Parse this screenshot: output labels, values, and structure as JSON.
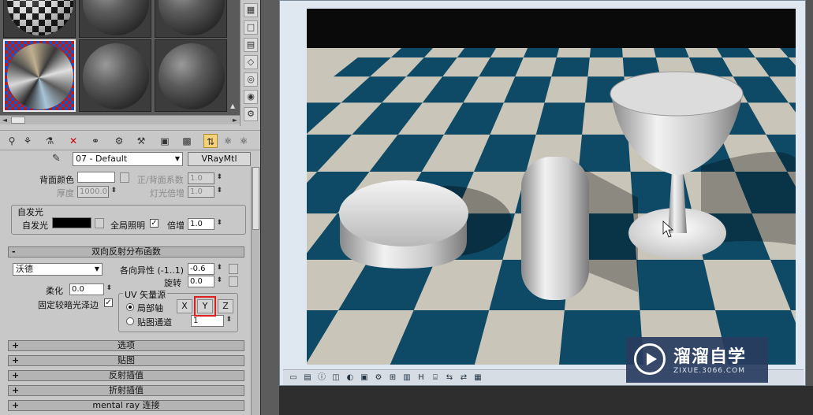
{
  "material_editor": {
    "material_name": "07 - Default",
    "material_type": "VRayMtl",
    "back_color": {
      "label": "背面颜色",
      "value": "#ffffff"
    },
    "front_back_coef": {
      "label": "正/背面系数",
      "value": "1.0"
    },
    "thickness": {
      "label": "厚度",
      "value": "1000.0"
    },
    "light_multiplier": {
      "label": "灯光倍增",
      "value": "1.0"
    },
    "self_illum": {
      "group_label": "自发光",
      "label": "自发光",
      "color": "#000000",
      "gi_label": "全局照明",
      "gi_checked": "✓",
      "mult_label": "倍增",
      "mult_value": "1.0"
    },
    "brdf": {
      "rollout_label": "双向反射分布函数",
      "rollout_sign": "-",
      "type": "沃德",
      "anisotropy_label": "各向异性 (-1..1)",
      "anisotropy_value": "-0.6",
      "rotation_label": "旋转",
      "rotation_value": "0.0",
      "soften_label": "柔化",
      "soften_value": "0.0",
      "fix_dark_label": "固定较暗光泽边",
      "fix_dark_checked": "✓",
      "uv_group_label": "UV 矢量源",
      "local_axis_label": "局部轴",
      "map_channel_label": "贴图通道",
      "map_channel_value": "1",
      "axis_x": "X",
      "axis_y": "Y",
      "axis_z": "Z"
    },
    "rollouts": [
      {
        "sign": "+",
        "label": "选项"
      },
      {
        "sign": "+",
        "label": "贴图"
      },
      {
        "sign": "+",
        "label": "反射插值"
      },
      {
        "sign": "+",
        "label": "折射插值"
      },
      {
        "sign": "+",
        "label": "mental ray 连接"
      }
    ],
    "icons": {
      "dropdown": "▼",
      "up": "▲",
      "down": "▼",
      "left": "◄",
      "right": "►"
    }
  },
  "watermark": {
    "title": "溜溜自学",
    "url": "ZIXUE.3066.COM"
  },
  "colors": {
    "checker_dark": "#0e4a66",
    "checker_light": "#c9c5b8",
    "highlight_box": "#e02020",
    "panel_bg": "#c8c8c8"
  }
}
